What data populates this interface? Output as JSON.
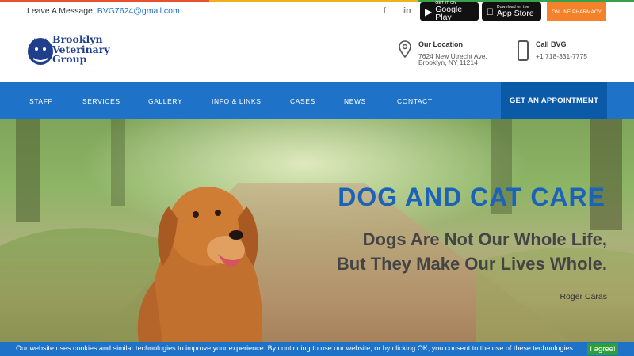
{
  "topbar": {
    "message_label": "Leave A Message:",
    "email": "BVG7624@gmail.com",
    "social": {
      "facebook": "f",
      "linkedin": "in"
    },
    "google_play": {
      "small": "GET IT ON",
      "big": "Google Play",
      "icon": "play-store-icon"
    },
    "app_store": {
      "small": "Download on the",
      "big": "App Store",
      "icon": "apple-icon"
    },
    "pharmacy": "ONLINE PHARMACY"
  },
  "header": {
    "logo": [
      "Brooklyn",
      "Veterinary",
      "Group"
    ],
    "location": {
      "title": "Our Location",
      "line1": "7624 New Utrecht Ave.",
      "line2": "Brooklyn, NY 11214"
    },
    "phone": {
      "title": "Call BVG",
      "number": "+1 718-331-7775"
    }
  },
  "nav": {
    "items": [
      "STAFF",
      "SERVICES",
      "GALLERY",
      "INFO & LINKS",
      "CASES",
      "NEWS",
      "CONTACT"
    ],
    "appointment": "GET AN APPOINTMENT"
  },
  "hero": {
    "title": "DOG AND CAT CARE",
    "quote_line1": "Dogs Are Not Our Whole Life,",
    "quote_line2": "But They Make Our Lives Whole.",
    "author": "Roger Caras"
  },
  "cookie": {
    "text": "Our website uses cookies and similar technologies to improve your experience. By continuing to use our website, or by clicking OK, you consent to the use of these technologies.",
    "button": "I agree!"
  },
  "colors": {
    "brand_blue": "#1e73c8",
    "nav_dark": "#0b5aa8",
    "pharmacy_orange": "#f4822a",
    "agree_green": "#2e9e3a"
  }
}
